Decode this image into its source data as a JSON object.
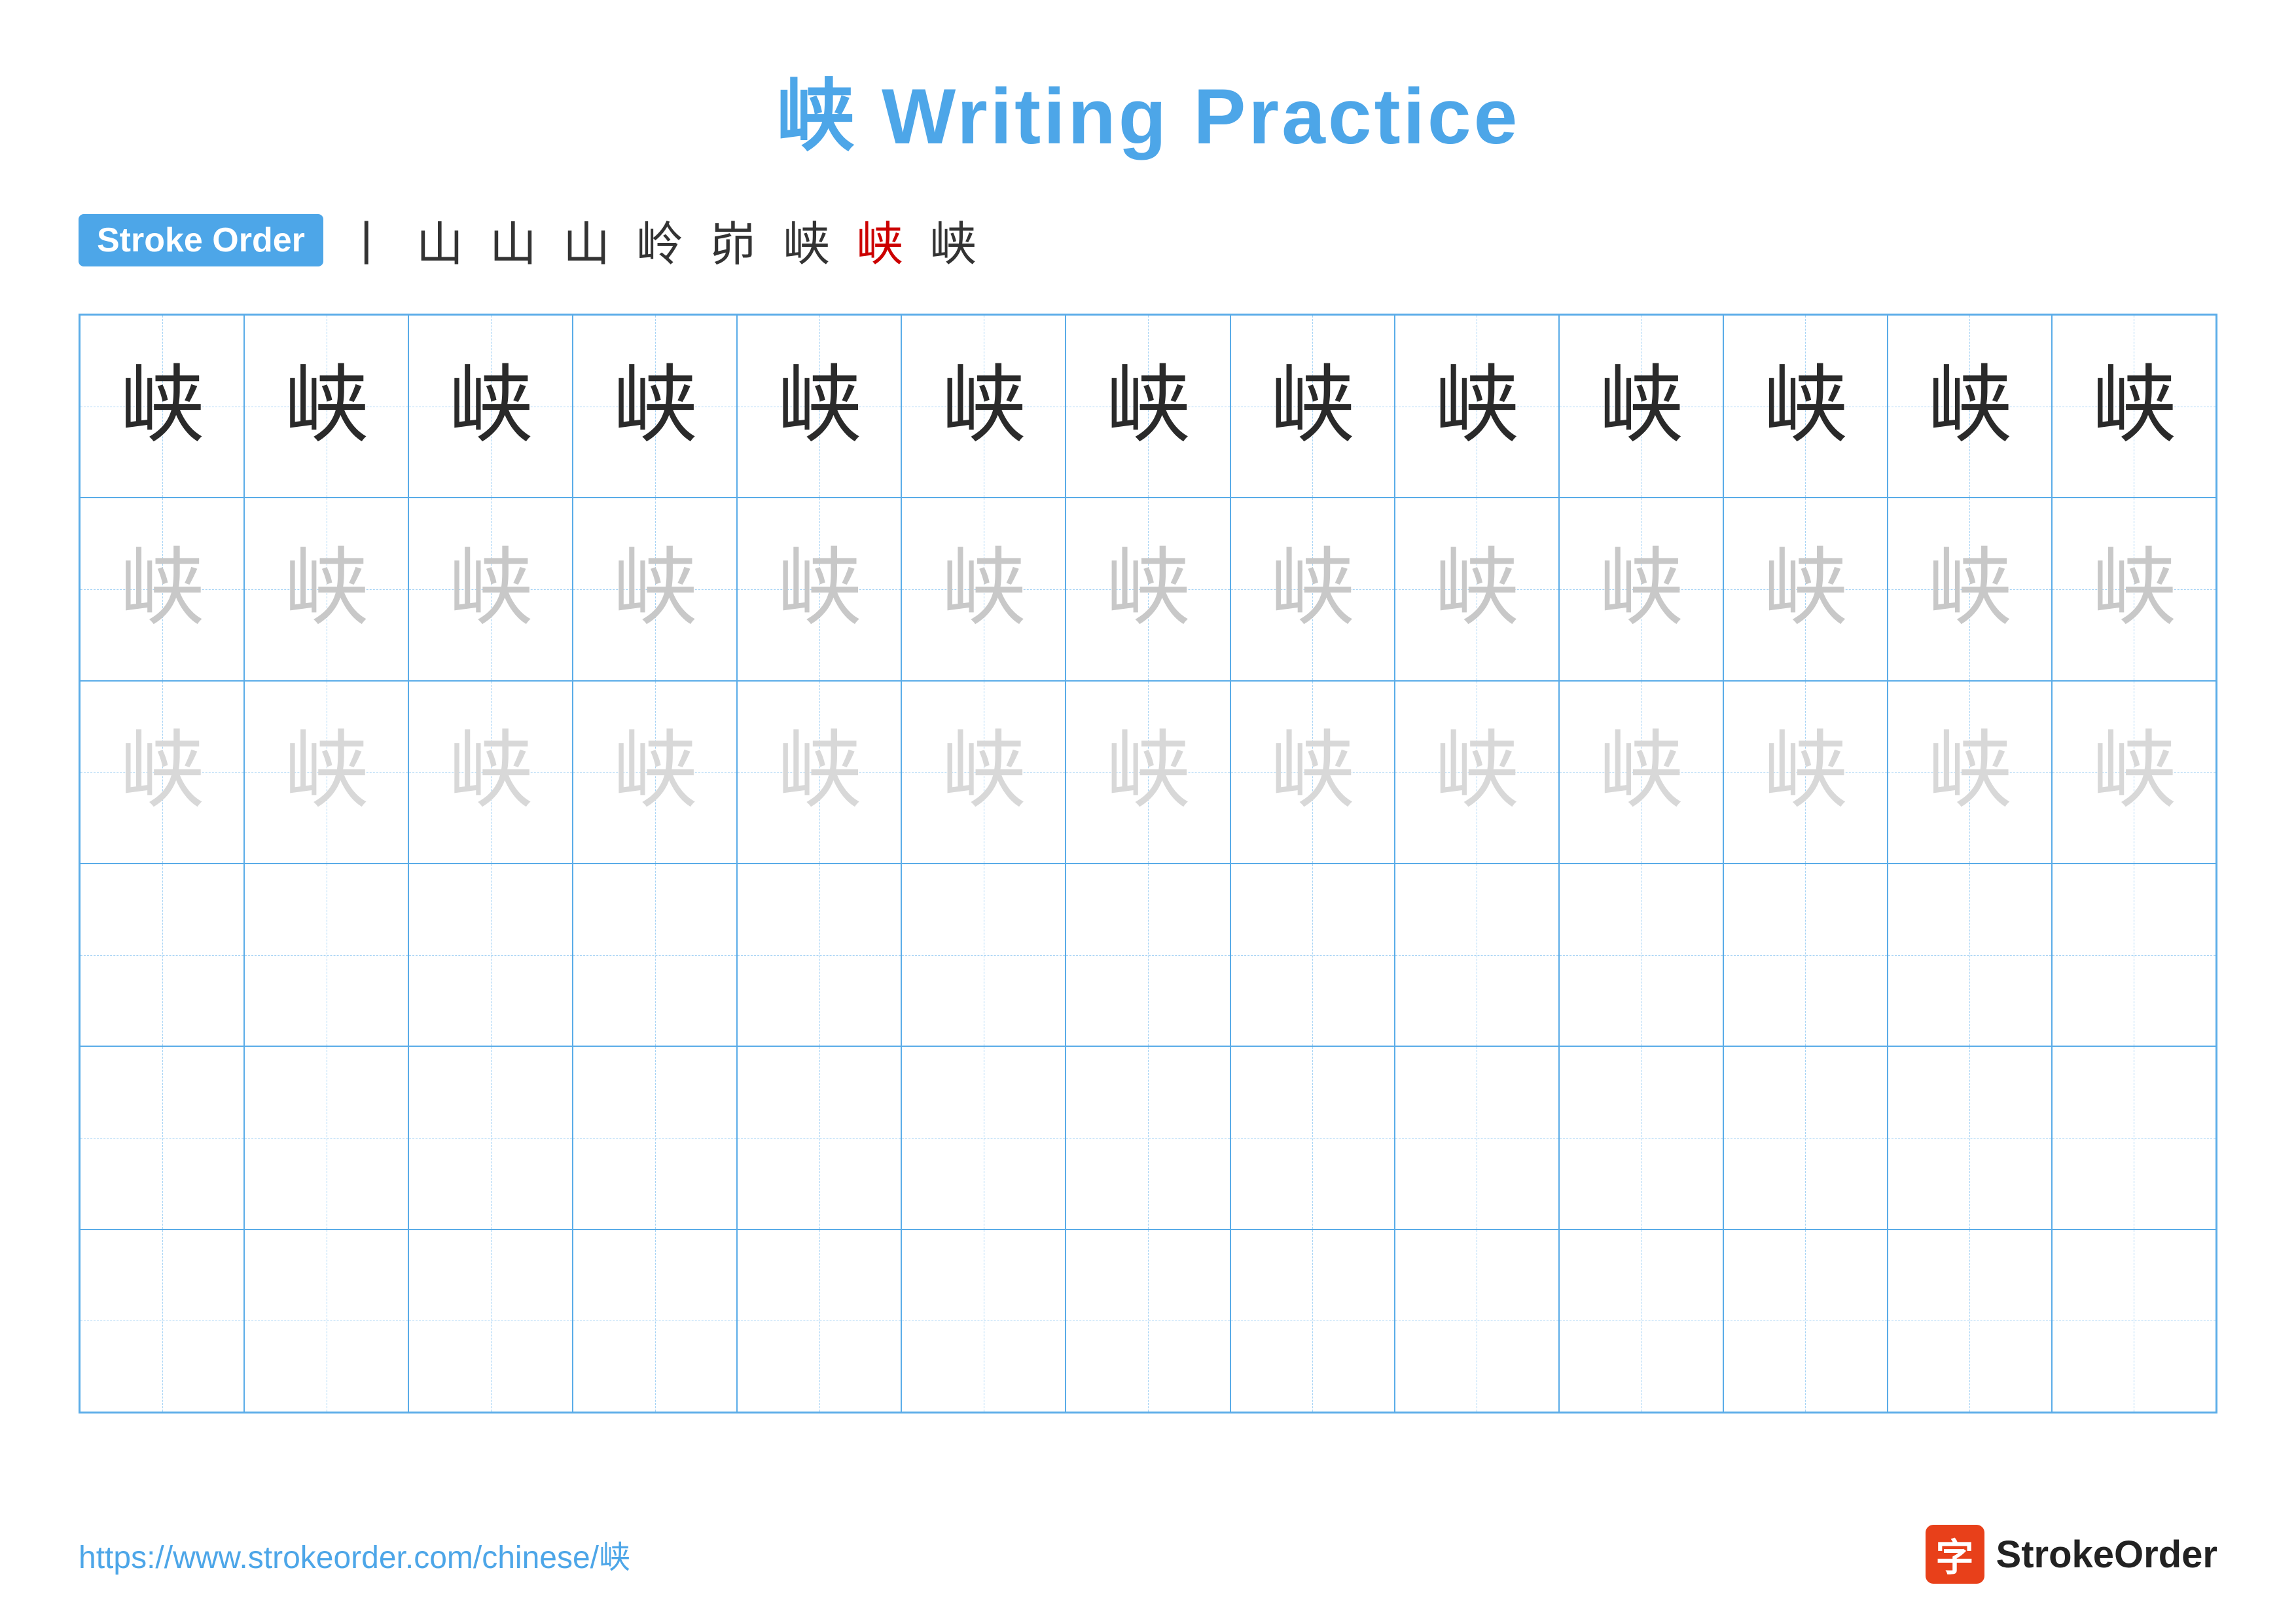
{
  "title": "峡 Writing Practice",
  "stroke_order": {
    "badge_label": "Stroke Order",
    "steps": [
      "丨",
      "山",
      "山",
      "山",
      "岭",
      "峁",
      "峡",
      "峡",
      "峡"
    ]
  },
  "character": "峡",
  "grid": {
    "rows": 6,
    "cols": 13,
    "row_types": [
      "dark",
      "light1",
      "light2",
      "empty",
      "empty",
      "empty"
    ]
  },
  "footer": {
    "url": "https://www.strokeorder.com/chinese/峡",
    "logo_char": "字",
    "logo_name": "StrokeOrder"
  }
}
